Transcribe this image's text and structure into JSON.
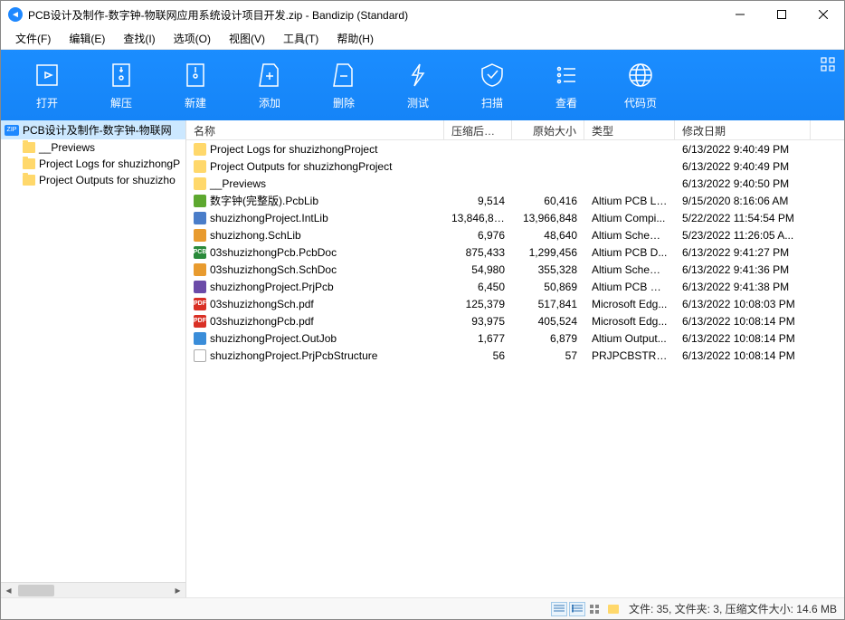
{
  "title": "PCB设计及制作-数字钟-物联网应用系统设计项目开发.zip - Bandizip (Standard)",
  "menu": {
    "file": "文件(F)",
    "edit": "编辑(E)",
    "find": "查找(I)",
    "option": "选项(O)",
    "view": "视图(V)",
    "tool": "工具(T)",
    "help": "帮助(H)"
  },
  "toolbar": {
    "open": "打开",
    "extract": "解压",
    "new": "新建",
    "add": "添加",
    "delete": "删除",
    "test": "测试",
    "scan": "扫描",
    "view": "查看",
    "codepage": "代码页"
  },
  "tree": {
    "root": "PCB设计及制作-数字钟-物联网",
    "items": [
      "__Previews",
      "Project Logs for shuzizhongP",
      "Project Outputs for shuzizho"
    ]
  },
  "columns": {
    "name": "名称",
    "compressed": "压缩后大小",
    "original": "原始大小",
    "type": "类型",
    "modified": "修改日期"
  },
  "rows": [
    {
      "icon": "folder",
      "name": "Project Logs for shuzizhongProject",
      "comp": "",
      "orig": "",
      "type": "",
      "date": "6/13/2022 9:40:49 PM"
    },
    {
      "icon": "folder",
      "name": "Project Outputs for shuzizhongProject",
      "comp": "",
      "orig": "",
      "type": "",
      "date": "6/13/2022 9:40:49 PM"
    },
    {
      "icon": "folder",
      "name": "__Previews",
      "comp": "",
      "orig": "",
      "type": "",
      "date": "6/13/2022 9:40:50 PM"
    },
    {
      "icon": "pcb",
      "name": "数字钟(完整版).PcbLib",
      "comp": "9,514",
      "orig": "60,416",
      "type": "Altium PCB Li...",
      "date": "9/15/2020 8:16:06 AM"
    },
    {
      "icon": "lib",
      "name": "shuzizhongProject.IntLib",
      "comp": "13,846,801",
      "orig": "13,966,848",
      "type": "Altium Compi...",
      "date": "5/22/2022 11:54:54 PM"
    },
    {
      "icon": "sch",
      "name": "shuzizhong.SchLib",
      "comp": "6,976",
      "orig": "48,640",
      "type": "Altium Schem...",
      "date": "5/23/2022 11:26:05 A..."
    },
    {
      "icon": "doc",
      "name": "03shuzizhongPcb.PcbDoc",
      "comp": "875,433",
      "orig": "1,299,456",
      "type": "Altium PCB D...",
      "date": "6/13/2022 9:41:27 PM"
    },
    {
      "icon": "sch",
      "name": "03shuzizhongSch.SchDoc",
      "comp": "54,980",
      "orig": "355,328",
      "type": "Altium Schem...",
      "date": "6/13/2022 9:41:36 PM"
    },
    {
      "icon": "prj",
      "name": "shuzizhongProject.PrjPcb",
      "comp": "6,450",
      "orig": "50,869",
      "type": "Altium PCB Pr...",
      "date": "6/13/2022 9:41:38 PM"
    },
    {
      "icon": "pdf",
      "name": "03shuzizhongSch.pdf",
      "comp": "125,379",
      "orig": "517,841",
      "type": "Microsoft Edg...",
      "date": "6/13/2022 10:08:03 PM"
    },
    {
      "icon": "pdf",
      "name": "03shuzizhongPcb.pdf",
      "comp": "93,975",
      "orig": "405,524",
      "type": "Microsoft Edg...",
      "date": "6/13/2022 10:08:14 PM"
    },
    {
      "icon": "out",
      "name": "shuzizhongProject.OutJob",
      "comp": "1,677",
      "orig": "6,879",
      "type": "Altium Output...",
      "date": "6/13/2022 10:08:14 PM"
    },
    {
      "icon": "file",
      "name": "shuzizhongProject.PrjPcbStructure",
      "comp": "56",
      "orig": "57",
      "type": "PRJPCBSTRUC...",
      "date": "6/13/2022 10:08:14 PM"
    }
  ],
  "status": "文件: 35, 文件夹: 3, 压缩文件大小: 14.6 MB"
}
